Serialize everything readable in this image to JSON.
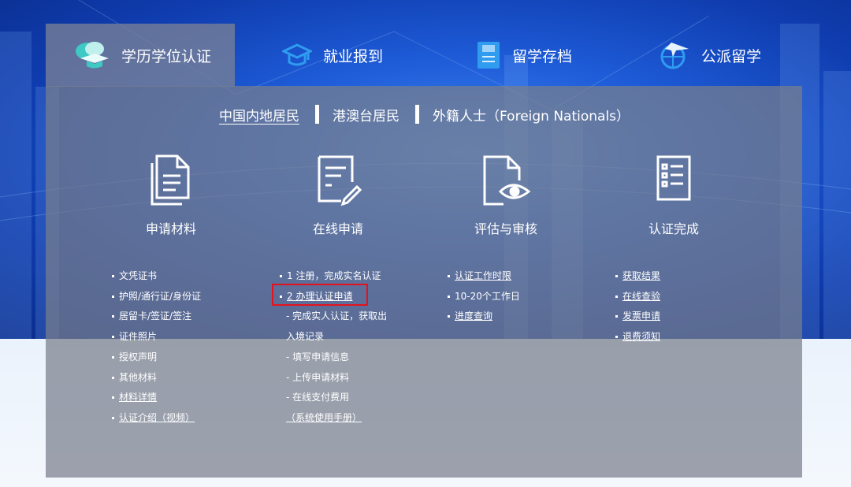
{
  "tabs": [
    {
      "label": "学历学位认证",
      "icon": "graduation-cap-icon",
      "active": true
    },
    {
      "label": "就业报到",
      "icon": "mortarboard-icon",
      "active": false
    },
    {
      "label": "留学存档",
      "icon": "archive-file-icon",
      "active": false
    },
    {
      "label": "公派留学",
      "icon": "globe-plane-icon",
      "active": false
    }
  ],
  "regions": [
    {
      "label": "中国内地居民",
      "active": true
    },
    {
      "label": "港澳台居民",
      "active": false
    },
    {
      "label": "外籍人士（Foreign Nationals）",
      "active": false
    }
  ],
  "steps": [
    {
      "label": "申请材料",
      "icon": "documents-icon"
    },
    {
      "label": "在线申请",
      "icon": "edit-form-icon"
    },
    {
      "label": "评估与审核",
      "icon": "file-eye-icon"
    },
    {
      "label": "认证完成",
      "icon": "checklist-icon"
    }
  ],
  "materials": [
    "文凭证书",
    "护照/通行证/身份证",
    "居留卡/签证/签注",
    "证件照片",
    "授权声明",
    "其他材料",
    "材料详情",
    "认证介绍（视频）"
  ],
  "apply": {
    "item1": "1 注册，完成实名认证",
    "item2": "2 办理认证申请",
    "sub1a": "- 完成实人认证，获取出",
    "sub1b": "入境记录",
    "sub2": "- 填写申请信息",
    "sub3": "- 上传申请材料",
    "sub4": "- 在线支付费用",
    "manual": "（系统使用手册）"
  },
  "review": [
    "认证工作时限",
    "10-20个工作日",
    "进度查询"
  ],
  "complete": [
    "获取结果",
    "在线查验",
    "发票申请",
    "退费须知"
  ],
  "colors": {
    "highlight": "#e4121f",
    "accent_teal": "#3ec9c4",
    "accent_blue": "#2f9cf0"
  }
}
